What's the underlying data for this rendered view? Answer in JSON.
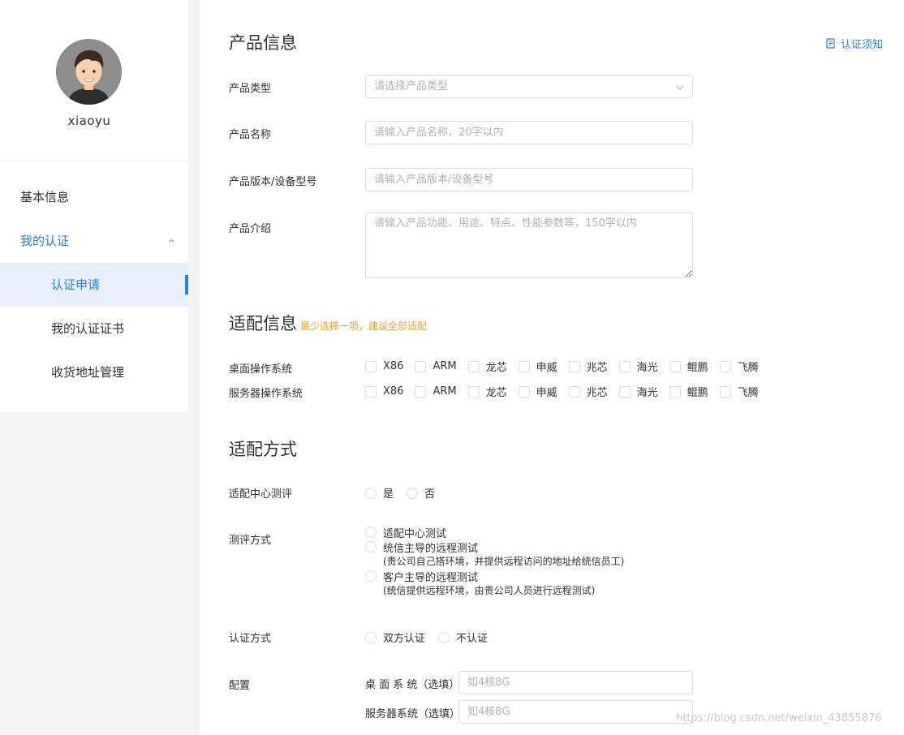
{
  "sidebar": {
    "username": "xiaoyu",
    "menu": {
      "basic_info": "基本信息",
      "my_cert": "我的认证",
      "cert_apply": "认证申请",
      "my_certificates": "我的认证证书",
      "address_mgmt": "收货地址管理"
    }
  },
  "product_info": {
    "title": "产品信息",
    "notice_link": "认证须知",
    "type_label": "产品类型",
    "type_placeholder": "请选择产品类型",
    "name_label": "产品名称",
    "name_placeholder": "请输入产品名称，20字以内",
    "version_label": "产品版本/设备型号",
    "version_placeholder": "请输入产品版本/设备型号",
    "intro_label": "产品介绍",
    "intro_placeholder": "请输入产品功能、用途、特点、性能参数等，150字以内"
  },
  "adapt_info": {
    "title": "适配信息",
    "hint": "最少选择一项，建议全部适配",
    "rows": [
      {
        "label": "桌面操作系统",
        "options": [
          "X86",
          "ARM",
          "龙芯",
          "申威",
          "兆芯",
          "海光",
          "鲲鹏",
          "飞腾"
        ]
      },
      {
        "label": "服务器操作系统",
        "options": [
          "X86",
          "ARM",
          "龙芯",
          "申威",
          "兆芯",
          "海光",
          "鲲鹏",
          "飞腾"
        ]
      }
    ]
  },
  "adapt_method": {
    "title": "适配方式",
    "center_eval_label": "适配中心测评",
    "center_eval_options": [
      "是",
      "否"
    ],
    "eval_method_label": "测评方式",
    "eval_methods": [
      {
        "label": "适配中心测试",
        "note": ""
      },
      {
        "label": "统信主导的远程测试",
        "note": "(贵公司自己搭环境，并提供远程访问的地址给统信员工)"
      },
      {
        "label": "客户主导的远程测试",
        "note": "(统信提供远程环境，由贵公司人员进行远程测试)"
      }
    ],
    "cert_method_label": "认证方式",
    "cert_method_options": [
      "双方认证",
      "不认证"
    ],
    "config_label": "配置",
    "desktop_config_label": "桌 面 系 统（选填）",
    "desktop_config_placeholder": "如4核8G",
    "server_config_label": "服务器系统（选填）",
    "server_config_placeholder": "如4核8G"
  },
  "watermark": "https://blog.csdn.net/weixin_43855876",
  "colors": {
    "accent": "#2f7de1",
    "hint": "#e6a23c",
    "border": "#dcdfe6"
  }
}
